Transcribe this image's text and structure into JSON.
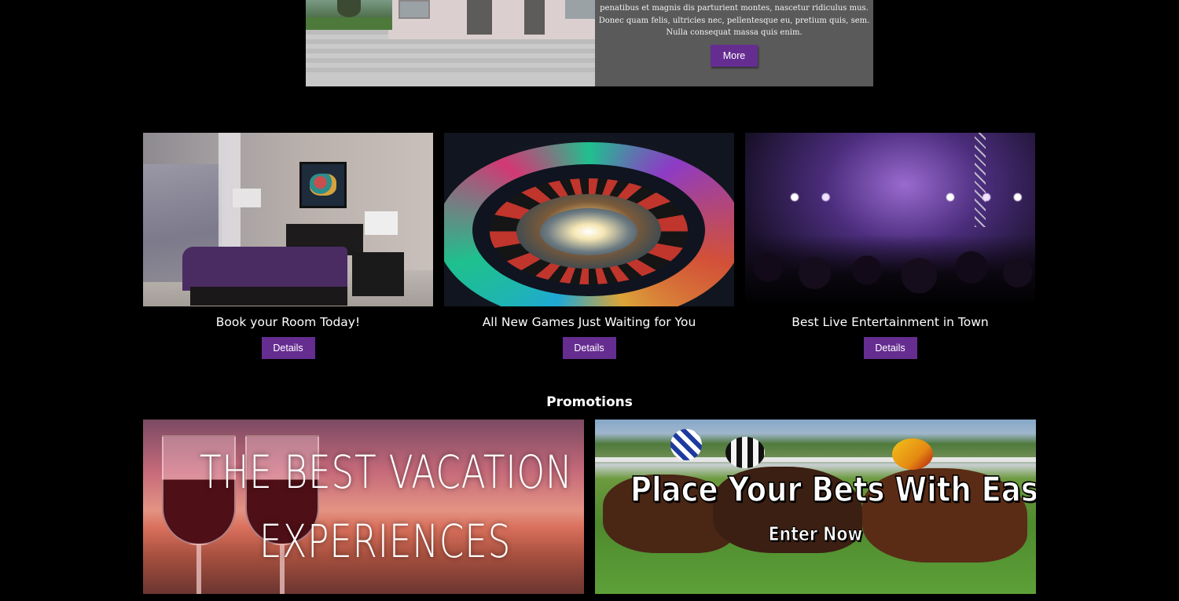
{
  "hero": {
    "text_lines": [
      "penatibus et magnis dis parturient montes, nascetur ridiculus mus.",
      "Donec quam felis, ultricies nec, pellentesque eu, pretium quis, sem.",
      "Nulla consequat massa quis enim."
    ],
    "more_label": "More"
  },
  "cards": [
    {
      "title": "Book your Room Today!",
      "button_label": "Details"
    },
    {
      "title": "All New Games Just Waiting for You",
      "button_label": "Details"
    },
    {
      "title": "Best Live Entertainment in Town",
      "button_label": "Details"
    }
  ],
  "promotions": {
    "heading": "Promotions",
    "vacation": {
      "line1": "THE BEST VACATION",
      "line2": "EXPERIENCES"
    },
    "bets": {
      "title": "Place Your Bets With Ease",
      "subtitle": "Enter Now"
    }
  },
  "colors": {
    "background": "#000000",
    "button": "#662d91",
    "hero_panel": "#5a5a5a"
  }
}
